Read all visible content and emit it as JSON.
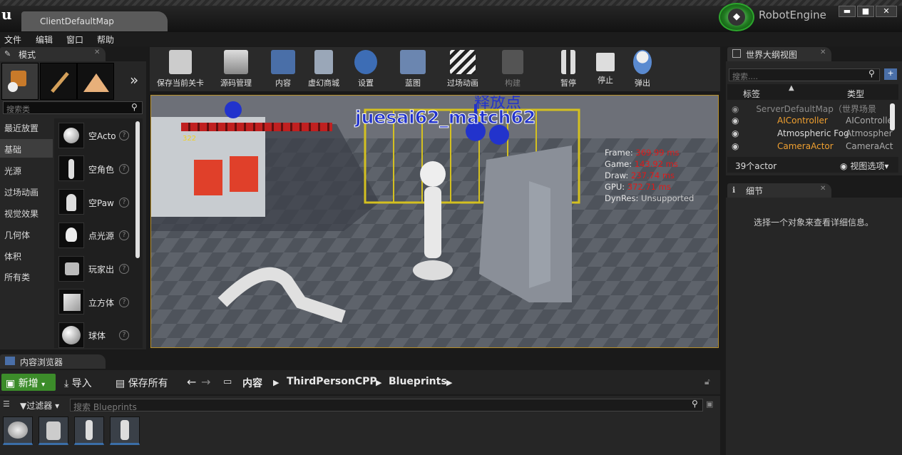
{
  "window": {
    "doc_tab": "ClientDefaultMap",
    "app_name": "RobotEngine",
    "minimize": "▬",
    "maximize": "■",
    "close": "✕"
  },
  "menu": [
    "文件",
    "编辑",
    "窗口",
    "帮助"
  ],
  "modes_panel": {
    "tab_label": "模式",
    "search_placeholder": "搜索类",
    "more": "»",
    "categories": [
      "最近放置",
      "基础",
      "光源",
      "过场动画",
      "视觉效果",
      "几何体",
      "体积",
      "所有类"
    ],
    "items": [
      "空Acto",
      "空角色",
      "空Paw",
      "点光源",
      "玩家出",
      "立方体",
      "球体"
    ],
    "help_glyph": "?"
  },
  "toolbar": {
    "buttons": [
      "保存当前关卡",
      "源码管理",
      "内容",
      "虚幻商城",
      "设置",
      "蓝图",
      "过场动画",
      "构建",
      "暂停",
      "停止",
      "弹出"
    ]
  },
  "viewport": {
    "overlay_name": "juesai62_match62",
    "overlay_partial": "释放点",
    "small_number": "322",
    "stats": [
      {
        "label": "Frame:",
        "value": "369.99 ms"
      },
      {
        "label": "Game:",
        "value": "143.92 ms"
      },
      {
        "label": "Draw:",
        "value": "237.74 ms"
      },
      {
        "label": "GPU:",
        "value": "372.71 ms"
      },
      {
        "label": "DynRes:",
        "value": "Unsupported"
      }
    ]
  },
  "outliner": {
    "tab_label": "世界大纲视图",
    "search_placeholder": "搜索....",
    "col_label": "标签",
    "col_type": "类型",
    "rows": [
      {
        "name": "ServerDefaultMap（世界场景",
        "type": ""
      },
      {
        "name": "AIController",
        "type": "AIControlle"
      },
      {
        "name": "Atmospheric Fog",
        "type": "Atmospher"
      },
      {
        "name": "CameraActor",
        "type": "CameraAct"
      }
    ],
    "count": "39个actor",
    "view_options": "视图选项"
  },
  "details": {
    "tab_label": "细节",
    "empty_message": "选择一个对象来查看详细信息。"
  },
  "content_browser": {
    "tab_label": "内容浏览器",
    "new_button": "新增",
    "import_button": "导入",
    "save_all_button": "保存所有",
    "path": [
      "内容",
      "ThirdPersonCPP",
      "Blueprints"
    ],
    "filter_label": "过滤器",
    "search_placeholder": "搜索 Blueprints"
  },
  "colors": {
    "accent_orange": "#f0a030",
    "viewport_border": "#b8902a",
    "stat_red": "#e01a1a",
    "new_button_green": "#3c8c2a",
    "overlay_blue": "#2233cc"
  }
}
